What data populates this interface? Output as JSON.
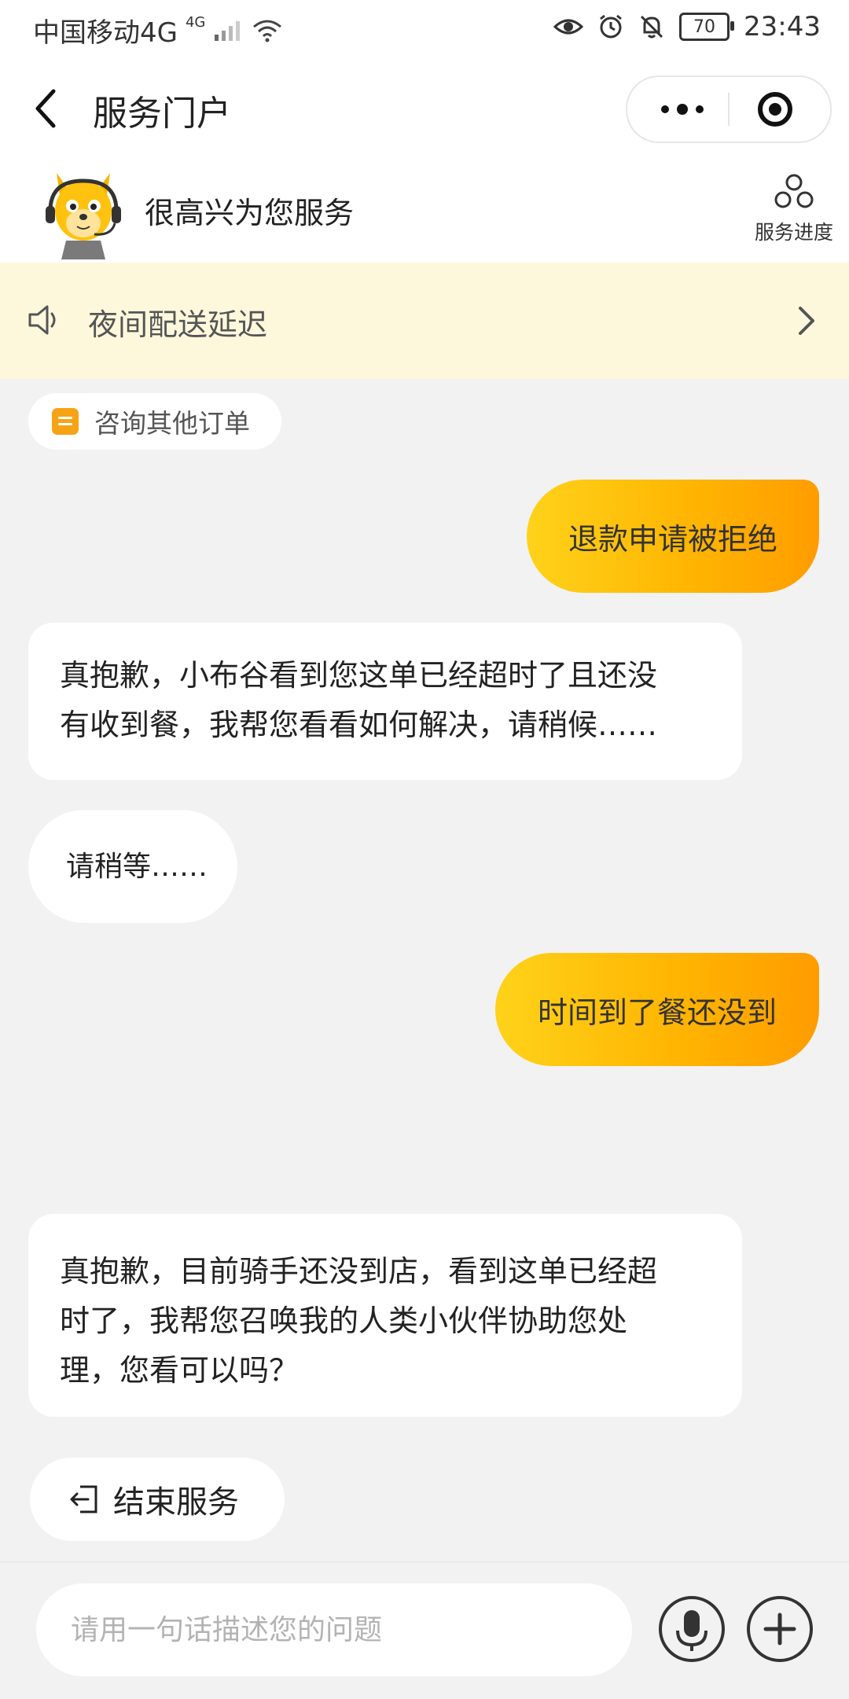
{
  "status_bar": {
    "carrier": "中国移动4G",
    "network_tag": "4G",
    "battery": "70",
    "time": "23:43"
  },
  "header": {
    "title": "服务门户"
  },
  "assistant": {
    "greeting": "很高兴为您服务",
    "progress_label": "服务进度"
  },
  "notice": {
    "text": "夜间配送延迟"
  },
  "order_chip": {
    "label": "咨询其他订单"
  },
  "messages": [
    {
      "from": "user",
      "text": "退款申请被拒绝"
    },
    {
      "from": "bot",
      "lines": [
        "真抱歉，小布谷看到您这单已经超时了且还没",
        "有收到餐，我帮您看看如何解决，请稍候……"
      ]
    },
    {
      "from": "bot",
      "text": "请稍等……"
    },
    {
      "from": "user",
      "text": "时间到了餐还没到"
    },
    {
      "from": "bot",
      "lines": [
        "真抱歉，目前骑手还没到店，看到这单已经超",
        "时了，我帮您召唤我的人类小伙伴协助您处",
        "理，您看可以吗？"
      ]
    }
  ],
  "end_service": {
    "label": "结束服务"
  },
  "input": {
    "placeholder": "请用一句话描述您的问题"
  },
  "colors": {
    "accent_start": "#ffd21a",
    "accent_end": "#ff9c00",
    "notice_bg": "#fdf8dc"
  }
}
